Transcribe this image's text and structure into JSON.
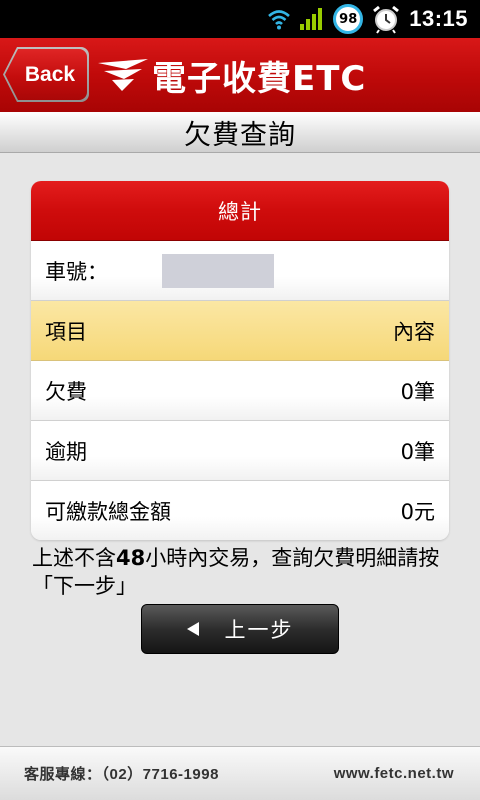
{
  "status_bar": {
    "battery_level": "98",
    "time": "13:15",
    "icons": [
      "wifi-icon",
      "signal-icon",
      "battery-icon",
      "alarm-icon"
    ]
  },
  "header": {
    "back_label": "Back",
    "logo_text": "電子收費ETC",
    "brand_color": "#c8102e"
  },
  "page": {
    "title": "欠費查詢"
  },
  "summary_card": {
    "title": "總計",
    "plate_label": "車號：",
    "plate_value": "",
    "columns": {
      "item": "項目",
      "content": "內容"
    },
    "rows": [
      {
        "label": "欠費",
        "value": "0筆"
      },
      {
        "label": "逾期",
        "value": "0筆"
      },
      {
        "label": "可繳款總金額",
        "value": "0元"
      }
    ]
  },
  "note": {
    "part1": "上述不含",
    "hours": "48",
    "part2": "小時內交易，查詢欠費明細請按「下一步」"
  },
  "prev_button": {
    "label": "上一步"
  },
  "footer": {
    "phone": "客服專線：（02）7716-1998",
    "url": "www.fetc.net.tw"
  }
}
